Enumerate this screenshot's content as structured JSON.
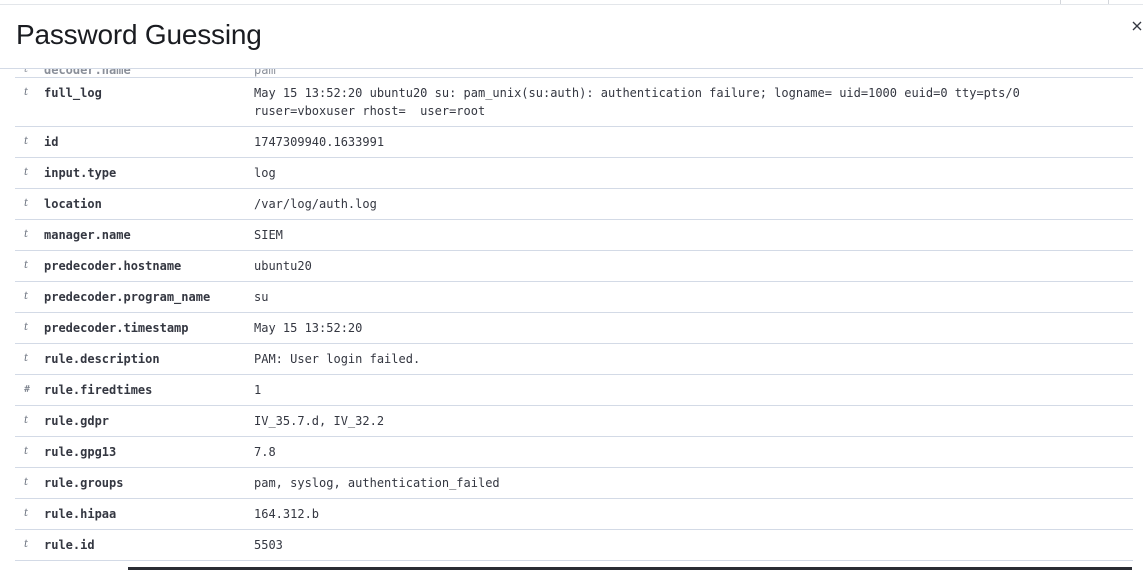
{
  "flyout": {
    "title": "Password Guessing",
    "close_icon": "close-icon"
  },
  "rows": [
    {
      "type": "t",
      "field": "decoder.name",
      "value": "pam"
    },
    {
      "type": "t",
      "field": "full_log",
      "value": "May 15 13:52:20 ubuntu20 su: pam_unix(su:auth): authentication failure; logname= uid=1000 euid=0 tty=pts/0 ruser=vboxuser rhost=  user=root"
    },
    {
      "type": "t",
      "field": "id",
      "value": "1747309940.1633991"
    },
    {
      "type": "t",
      "field": "input.type",
      "value": "log"
    },
    {
      "type": "t",
      "field": "location",
      "value": "/var/log/auth.log"
    },
    {
      "type": "t",
      "field": "manager.name",
      "value": "SIEM"
    },
    {
      "type": "t",
      "field": "predecoder.hostname",
      "value": "ubuntu20"
    },
    {
      "type": "t",
      "field": "predecoder.program_name",
      "value": "su"
    },
    {
      "type": "t",
      "field": "predecoder.timestamp",
      "value": "May 15 13:52:20"
    },
    {
      "type": "t",
      "field": "rule.description",
      "value": "PAM: User login failed."
    },
    {
      "type": "#",
      "field": "rule.firedtimes",
      "value": "1"
    },
    {
      "type": "t",
      "field": "rule.gdpr",
      "value": "IV_35.7.d, IV_32.2"
    },
    {
      "type": "t",
      "field": "rule.gpg13",
      "value": "7.8"
    },
    {
      "type": "t",
      "field": "rule.groups",
      "value": "pam, syslog, authentication_failed"
    },
    {
      "type": "t",
      "field": "rule.hipaa",
      "value": "164.312.b"
    },
    {
      "type": "t",
      "field": "rule.id",
      "value": "5503"
    }
  ]
}
